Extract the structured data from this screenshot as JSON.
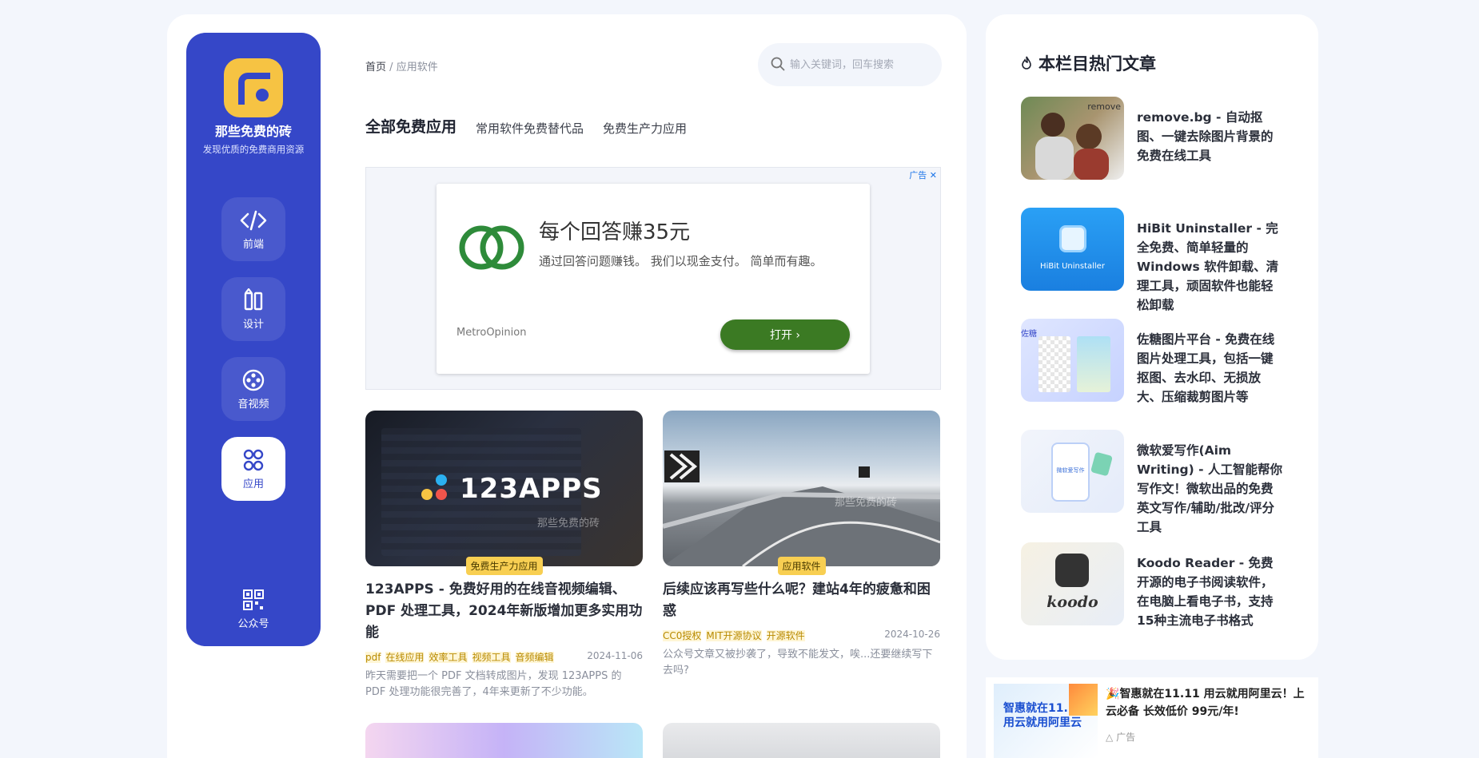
{
  "site": {
    "name": "那些免费的砖",
    "subtitle": "发现优质的免费商用资源"
  },
  "nav": {
    "items": [
      {
        "label": "前端",
        "icon": "code-icon"
      },
      {
        "label": "设计",
        "icon": "design-icon"
      },
      {
        "label": "音视频",
        "icon": "film-reel-icon"
      },
      {
        "label": "应用",
        "icon": "apps-grid-icon"
      }
    ],
    "qr_label": "公众号"
  },
  "breadcrumb": {
    "home": "首页",
    "sep": "/",
    "current": "应用软件"
  },
  "search": {
    "placeholder": "输入关键词，回车搜索"
  },
  "tabs": [
    "全部免费应用",
    "常用软件免费替代品",
    "免费生产力应用"
  ],
  "ad": {
    "marker": "广告",
    "title": "每个回答赚35元",
    "desc": "通过回答问题赚钱。 我们以现金支付。 简单而有趣。",
    "brand": "MetroOpinion",
    "button": "打开"
  },
  "posts": [
    {
      "thumb_text": "123APPS",
      "watermark": "那些免费的砖",
      "category": "免费生产力应用",
      "title": "123APPS - 免费好用的在线音视频编辑、PDF 处理工具，2024年新版增加更多实用功能",
      "tags": [
        "pdf",
        "在线应用",
        "效率工具",
        "视频工具",
        "音频编辑"
      ],
      "date": "2024-11-06",
      "excerpt": "昨天需要把一个 PDF 文档转成图片，发现 123APPS 的 PDF 处理功能很完善了，4年来更新了不少功能。"
    },
    {
      "watermark": "那些免费的砖",
      "category": "应用软件",
      "title": "后续应该再写些什么呢？建站4年的疲惫和困惑",
      "tags": [
        "CC0授权",
        "MIT开源协议",
        "开源软件"
      ],
      "date": "2024-10-26",
      "excerpt": "公众号文章又被抄袭了，导致不能发文，唉...还要继续写下去吗?"
    }
  ],
  "sidebar": {
    "title": "本栏目热门文章",
    "hot": [
      {
        "title": "remove.bg - 自动抠图、一键去除图片背景的免费在线工具",
        "thumb_text": "remove"
      },
      {
        "title": "HiBit Uninstaller - 完全免费、简单轻量的 Windows 软件卸载、清理工具，顽固软件也能轻松卸载",
        "thumb_text": "HiBit Uninstaller"
      },
      {
        "title": "佐糖图片平台 - 免费在线图片处理工具，包括一键抠图、去水印、无损放大、压缩裁剪图片等",
        "thumb_text": "佐糖"
      },
      {
        "title": "微软爱写作(Aim Writing) - 人工智能帮你写作文！微软出品的免费英文写作/辅助/批改/评分工具",
        "thumb_text": "微软爱写作"
      },
      {
        "title": "Koodo Reader - 免费开源的电子书阅读软件，在电脑上看电子书，支持15种主流电子书格式",
        "thumb_text": "koodo"
      }
    ],
    "ad": {
      "thumb_text": "智惠就在11.11 用云就用阿里云",
      "title": "智惠就在11.11 用云就用阿里云！上云必备 长效低价 99元/年!",
      "label": "广告"
    }
  },
  "colors": {
    "nav_bg": "#3547c8",
    "accent_yellow": "#f6c343",
    "ad_button": "#3b7a23"
  }
}
